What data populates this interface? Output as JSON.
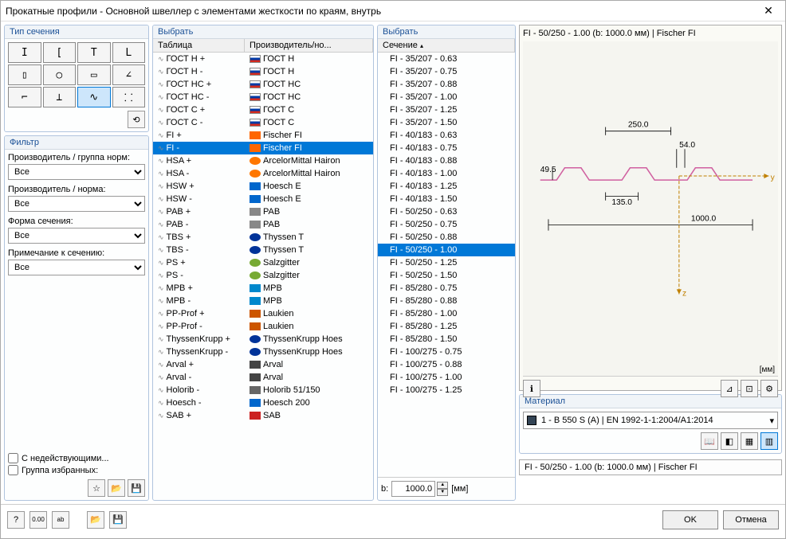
{
  "window": {
    "title": "Прокатные профили - Основной швеллер с элементами жесткости по краям, внутрь"
  },
  "groups": {
    "section_type": "Тип сечения",
    "filter": "Фильтр",
    "select1": "Выбрать",
    "select2": "Выбрать",
    "material": "Материал"
  },
  "filter": {
    "label_mfr_group": "Производитель / группа норм:",
    "label_mfr_norm": "Производитель / норма:",
    "label_shape": "Форма сечения:",
    "label_note": "Примечание к сечению:",
    "value_all": "Все",
    "cb_inactive": "С недействующими...",
    "cb_favorites": "Группа избранных:"
  },
  "table1": {
    "col_table": "Таблица",
    "col_mfr": "Производитель/но...",
    "rows": [
      {
        "t": "ГОСТ Н +",
        "m": "ГОСТ Н",
        "b": "ru"
      },
      {
        "t": "ГОСТ Н -",
        "m": "ГОСТ Н",
        "b": "ru"
      },
      {
        "t": "ГОСТ НС +",
        "m": "ГОСТ НС",
        "b": "ru"
      },
      {
        "t": "ГОСТ НС -",
        "m": "ГОСТ НС",
        "b": "ru"
      },
      {
        "t": "ГОСТ С +",
        "m": "ГОСТ С",
        "b": "ru"
      },
      {
        "t": "ГОСТ С -",
        "m": "ГОСТ С",
        "b": "ru"
      },
      {
        "t": "FI +",
        "m": "Fischer FI",
        "b": "fischer"
      },
      {
        "t": "FI -",
        "m": "Fischer FI",
        "b": "fischer",
        "sel": true
      },
      {
        "t": "HSA +",
        "m": "ArcelorMittal Hairon",
        "b": "am"
      },
      {
        "t": "HSA -",
        "m": "ArcelorMittal Hairon",
        "b": "am"
      },
      {
        "t": "HSW +",
        "m": "Hoesch E",
        "b": "hoesch"
      },
      {
        "t": "HSW -",
        "m": "Hoesch E",
        "b": "hoesch"
      },
      {
        "t": "PAB +",
        "m": "PAB",
        "b": "pab"
      },
      {
        "t": "PAB -",
        "m": "PAB",
        "b": "pab"
      },
      {
        "t": "TBS +",
        "m": "Thyssen T",
        "b": "thyssen"
      },
      {
        "t": "TBS -",
        "m": "Thyssen T",
        "b": "thyssen"
      },
      {
        "t": "PS +",
        "m": "Salzgitter",
        "b": "salz"
      },
      {
        "t": "PS -",
        "m": "Salzgitter",
        "b": "salz"
      },
      {
        "t": "MPB +",
        "m": "MPB",
        "b": "mpb"
      },
      {
        "t": "MPB -",
        "m": "MPB",
        "b": "mpb"
      },
      {
        "t": "PP-Prof +",
        "m": "Laukien",
        "b": "lkn"
      },
      {
        "t": "PP-Prof -",
        "m": "Laukien",
        "b": "lkn"
      },
      {
        "t": "ThyssenKrupp +",
        "m": "ThyssenKrupp Hoes",
        "b": "thyssen"
      },
      {
        "t": "ThyssenKrupp -",
        "m": "ThyssenKrupp Hoes",
        "b": "thyssen"
      },
      {
        "t": "Arval +",
        "m": "Arval",
        "b": "arval"
      },
      {
        "t": "Arval -",
        "m": "Arval",
        "b": "arval"
      },
      {
        "t": "Holorib -",
        "m": "Holorib 51/150",
        "b": "holorib"
      },
      {
        "t": "Hoesch -",
        "m": "Hoesch 200",
        "b": "hoesch"
      },
      {
        "t": "SAB +",
        "m": "SAB",
        "b": "sab"
      }
    ]
  },
  "table2": {
    "col_section": "Сечение",
    "rows": [
      "FI - 35/207 - 0.63",
      "FI - 35/207 - 0.75",
      "FI - 35/207 - 0.88",
      "FI - 35/207 - 1.00",
      "FI - 35/207 - 1.25",
      "FI - 35/207 - 1.50",
      "FI - 40/183 - 0.63",
      "FI - 40/183 - 0.75",
      "FI - 40/183 - 0.88",
      "FI - 40/183 - 1.00",
      "FI - 40/183 - 1.25",
      "FI - 40/183 - 1.50",
      "FI - 50/250 - 0.63",
      "FI - 50/250 - 0.75",
      "FI - 50/250 - 0.88",
      "FI - 50/250 - 1.00",
      "FI - 50/250 - 1.25",
      "FI - 50/250 - 1.50",
      "FI - 85/280 - 0.75",
      "FI - 85/280 - 0.88",
      "FI - 85/280 - 1.00",
      "FI - 85/280 - 1.25",
      "FI - 85/280 - 1.50",
      "FI - 100/275 - 0.75",
      "FI - 100/275 - 0.88",
      "FI - 100/275 - 1.00",
      "FI - 100/275 - 1.25"
    ],
    "selected_index": 15
  },
  "preview": {
    "title": "FI - 50/250 - 1.00 (b: 1000.0 мм) | Fischer FI",
    "unit": "[мм]",
    "dims": {
      "d250": "250.0",
      "d54": "54.0",
      "d495": "49.5",
      "d135": "135.0",
      "d1000": "1000.0"
    },
    "y": "y",
    "z": "z"
  },
  "b_input": {
    "label": "b:",
    "value": "1000.0",
    "unit": "[мм]"
  },
  "material": {
    "selected": "1 - B 550 S (A) | EN 1992-1-1:2004/A1:2014"
  },
  "status": "FI - 50/250 - 1.00 (b: 1000.0 мм) | Fischer FI",
  "buttons": {
    "ok": "OK",
    "cancel": "Отмена"
  }
}
